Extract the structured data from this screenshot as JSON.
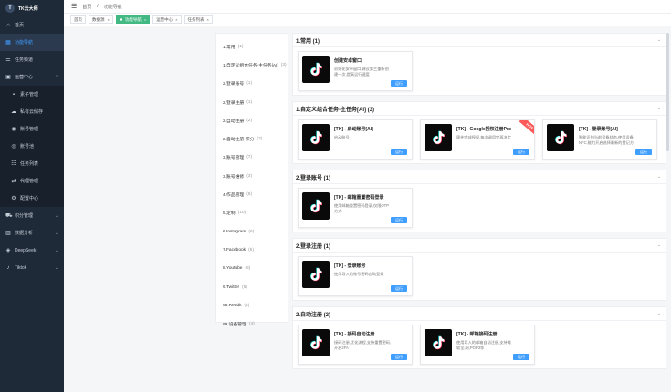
{
  "logo": {
    "mark": "T",
    "text": "TK云大师"
  },
  "sidebar": {
    "items": [
      {
        "label": "首页",
        "icon": "home-icon",
        "glyph": "⌂"
      },
      {
        "label": "功能导航",
        "icon": "grid-icon",
        "glyph": "▦"
      },
      {
        "label": "任务频道",
        "icon": "list-icon",
        "glyph": "☰"
      },
      {
        "label": "运营中心",
        "icon": "briefcase-icon",
        "glyph": "▣",
        "chev": "⌃"
      }
    ],
    "sub": [
      {
        "label": "素子管理",
        "icon": "box-icon",
        "glyph": "▪"
      },
      {
        "label": "私有云储存",
        "icon": "cloud-icon",
        "glyph": "☁"
      },
      {
        "label": "账号管理",
        "icon": "user-icon",
        "glyph": "◉"
      },
      {
        "label": "账号池",
        "icon": "pool-icon",
        "glyph": "◎"
      },
      {
        "label": "任务列表",
        "icon": "task-icon",
        "glyph": "☷"
      },
      {
        "label": "代理管理",
        "icon": "proxy-icon",
        "glyph": "⇄"
      },
      {
        "label": "配置中心",
        "icon": "gear-icon",
        "glyph": "⚙"
      }
    ],
    "after": [
      {
        "label": "积分管理",
        "icon": "cart-icon",
        "glyph": "⛟",
        "chev": "⌄"
      },
      {
        "label": "数据分析",
        "icon": "chart-icon",
        "glyph": "▥",
        "chev": "⌄"
      },
      {
        "label": "DeepSeek",
        "icon": "deepseek-icon",
        "glyph": "◈",
        "chev": "⌄"
      },
      {
        "label": "Tiktok",
        "icon": "tiktok-icon",
        "glyph": "♪",
        "chev": "⌄"
      }
    ]
  },
  "header": {
    "menu_icon": "☰",
    "crumbs": [
      "首页",
      "/",
      "功能导航"
    ]
  },
  "tags": [
    {
      "label": "首页",
      "active": false
    },
    {
      "label": "数据源",
      "active": false,
      "close": "×"
    },
    {
      "label": "功能导航",
      "active": true,
      "close": "×"
    },
    {
      "label": "运营中心",
      "active": false,
      "close": "×"
    },
    {
      "label": "任务列表",
      "active": false,
      "close": "×"
    }
  ],
  "categories": [
    {
      "label": "1.常用",
      "count": "(1)"
    },
    {
      "label": "1.自定义组合任务-主任务[AI]",
      "count": "(3)"
    },
    {
      "label": "2.登录账号",
      "count": "(1)"
    },
    {
      "label": "2.登录注册",
      "count": "(1)"
    },
    {
      "label": "2.自动注册",
      "count": "(2)"
    },
    {
      "label": "2.自动注册-积分",
      "count": "(3)"
    },
    {
      "label": "3.账号管理",
      "count": "(7)"
    },
    {
      "label": "3.账号维修",
      "count": "(3)"
    },
    {
      "label": "4.作品管理",
      "count": "(8)"
    },
    {
      "label": "5.定制",
      "count": "(10)"
    },
    {
      "label": "6.Instagram",
      "count": "(6)"
    },
    {
      "label": "7.Facebook",
      "count": "(5)"
    },
    {
      "label": "8.Youtube",
      "count": "(8)"
    },
    {
      "label": "9.Twitter",
      "count": "(5)"
    },
    {
      "label": "98.Reddit",
      "count": "(2)"
    },
    {
      "label": "99.设备管理",
      "count": "(4)"
    }
  ],
  "sections": [
    {
      "title": "1.常用 (1)",
      "cards": [
        {
          "title": "创建安卓窗口",
          "desc": "初始化安卓窗口,建议第三重新创建一次,提高运行速度",
          "btn": "运行"
        }
      ]
    },
    {
      "title": "1.自定义组合任务-主任务[AI] (3)",
      "cards": [
        {
          "title": "[TK] - 启动账号[AI]",
          "desc": "启动账号",
          "btn": "运行"
        },
        {
          "title": "[TK] - Google授权注册Pro",
          "desc": "周先完成授权,每次调用完再决定",
          "btn": "运行",
          "hot": "HOT"
        },
        {
          "title": "[TK] - 登录账号[AI]",
          "desc": "智能识别当前设备状态,使用设备NFC,能力开启选择最新的登记方式",
          "btn": "运行"
        }
      ]
    },
    {
      "title": "2.登录账号 (1)",
      "cards": [
        {
          "title": "[TK] - 邮箱重置密码登录",
          "desc": "使用邮箱重置密码登录,仅限OTP方式",
          "btn": "运行"
        }
      ]
    },
    {
      "title": "2.登录注册 (1)",
      "cards": [
        {
          "title": "[TK] - 登录账号",
          "desc": "使用导入的账号密码自动登录",
          "btn": "运行"
        }
      ]
    },
    {
      "title": "2.自动注册 (2)",
      "cards": [
        {
          "title": "[TK] - 接码自动注册",
          "desc": "接码注册,优化流程,支持重置密码,开启2FA",
          "btn": "运行"
        },
        {
          "title": "[TK] - 邮箱接码注册",
          "desc": "使用导入的邮箱自动注册,支持微软全,网,POP3等",
          "btn": "运行"
        }
      ]
    }
  ]
}
